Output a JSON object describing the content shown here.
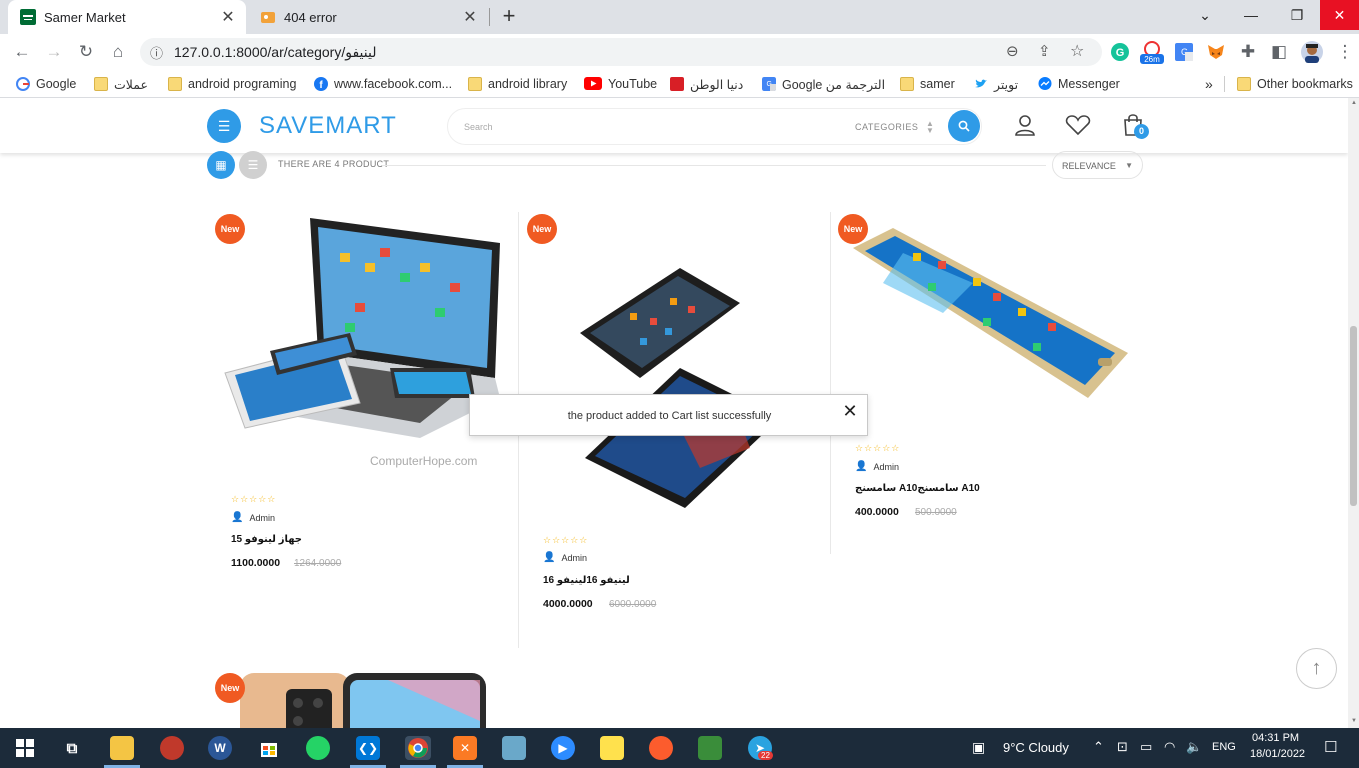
{
  "browser": {
    "tabs": [
      {
        "title": "Samer Market",
        "active": true
      },
      {
        "title": "404 error",
        "active": false
      }
    ],
    "new_tab": "+",
    "url": "127.0.0.1:8000/ar/category/لينيفو",
    "bookmarks": [
      {
        "label": "Google",
        "icon": "google-icon"
      },
      {
        "label": "عملات",
        "icon": "folder-icon"
      },
      {
        "label": "android programing",
        "icon": "folder-icon"
      },
      {
        "label": "www.facebook.com...",
        "icon": "facebook-icon"
      },
      {
        "label": "android library",
        "icon": "folder-icon"
      },
      {
        "label": "YouTube",
        "icon": "youtube-icon"
      },
      {
        "label": "دنيا الوطن",
        "icon": "dunya-icon"
      },
      {
        "label": "Google الترجمة من",
        "icon": "translate-icon"
      },
      {
        "label": "samer",
        "icon": "folder-icon"
      },
      {
        "label": "تويتر",
        "icon": "twitter-icon"
      },
      {
        "label": "Messenger",
        "icon": "messenger-icon"
      }
    ],
    "more_bookmarks": "»",
    "other_bookmarks": "Other bookmarks",
    "extension_badge": "26m"
  },
  "site": {
    "logo": "SAVEMART",
    "search_placeholder": "Search",
    "categories_label": "CATEGORIES",
    "cart_count": "0",
    "product_count_text": "THERE ARE 4 PRODUCT",
    "sort_label": "RELEVANCE",
    "new_badge": "New",
    "stars": "☆☆☆☆☆",
    "toast_message": "the product added to Cart list successfully",
    "products": [
      {
        "name": "جهاز لينوفو 15",
        "author": "Admin",
        "price": "1100.0000",
        "old_price": "1264.0000",
        "watermark": "ComputerHope.com"
      },
      {
        "name": "لينيفو 16لينيفو 16",
        "author": "Admin",
        "price": "4000.0000",
        "old_price": "6000.0000"
      },
      {
        "name": "سامسنج A10سامسنج A10",
        "author": "Admin",
        "price": "400.0000",
        "old_price": "500.0000"
      }
    ]
  },
  "taskbar": {
    "weather": "9°C  Cloudy",
    "lang": "ENG",
    "time": "04:31 PM",
    "date": "18/01/2022",
    "telegram_badge": "22"
  },
  "colors": {
    "accent": "#2f9be7",
    "new_badge": "#f05a22",
    "star": "#f3b81b",
    "taskbar": "#1c2b3a"
  }
}
